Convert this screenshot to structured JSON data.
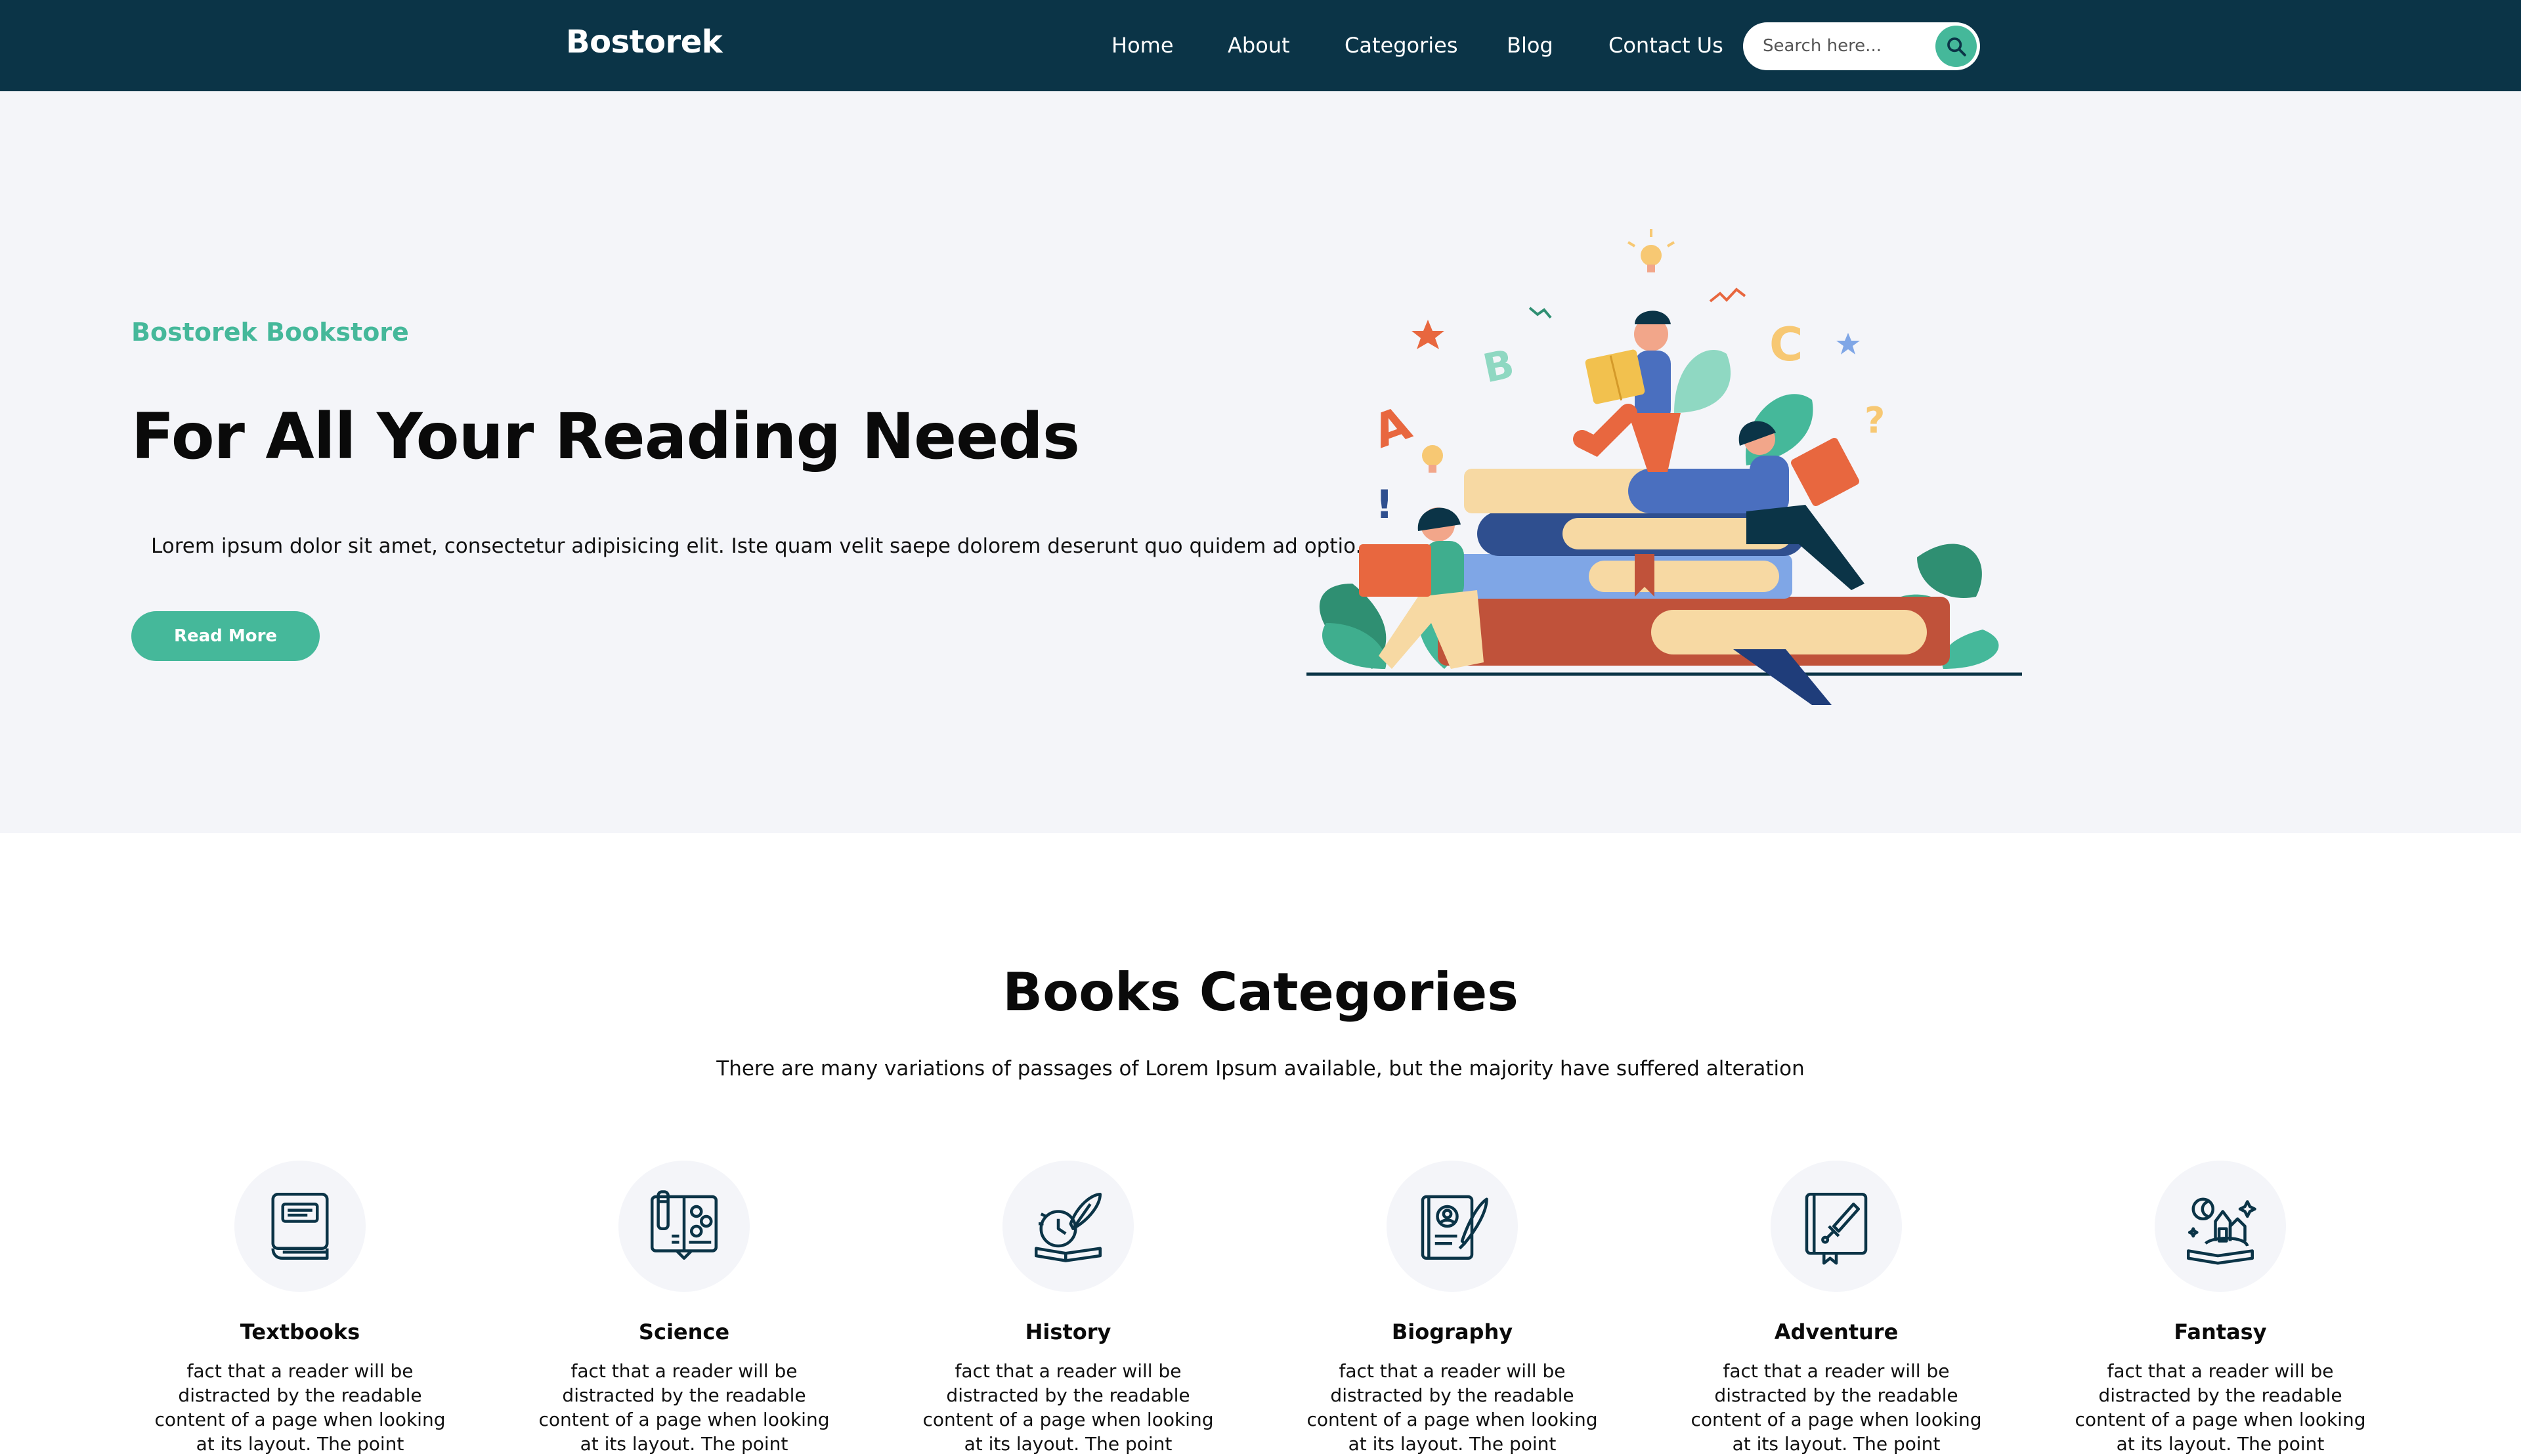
{
  "nav": {
    "brand": "Bostorek",
    "links": [
      "Home",
      "About",
      "Categories",
      "Blog",
      "Contact Us"
    ],
    "search_placeholder": "Search here..."
  },
  "hero": {
    "kicker": "Bostorek Bookstore",
    "title": "For All Your Reading Needs",
    "text": "Lorem ipsum dolor sit amet, consectetur adipisicing elit. Iste quam velit saepe dolorem deserunt quo quidem ad optio.",
    "button": "Read More"
  },
  "illustration_letters": [
    "A",
    "B",
    "C",
    "?",
    "!"
  ],
  "categories": {
    "title": "Books Categories",
    "subtitle": "There are many variations of passages of Lorem Ipsum available, but the majority have suffered alteration",
    "items": [
      {
        "name": "Textbooks",
        "icon": "textbook-icon",
        "desc": "fact that a reader will be distracted by the readable content of a page when looking at its layout. The point"
      },
      {
        "name": "Science",
        "icon": "science-icon",
        "desc": "fact that a reader will be distracted by the readable content of a page when looking at its layout. The point"
      },
      {
        "name": "History",
        "icon": "history-icon",
        "desc": "fact that a reader will be distracted by the readable content of a page when looking at its layout. The point"
      },
      {
        "name": "Biography",
        "icon": "biography-icon",
        "desc": "fact that a reader will be distracted by the readable content of a page when looking at its layout. The point"
      },
      {
        "name": "Adventure",
        "icon": "adventure-icon",
        "desc": "fact that a reader will be distracted by the readable content of a page when looking at its layout. The point"
      },
      {
        "name": "Fantasy",
        "icon": "fantasy-icon",
        "desc": "fact that a reader will be distracted by the readable content of a page when looking at its layout. The point"
      }
    ]
  },
  "colors": {
    "navbar": "#0b3447",
    "accent": "#45b89a",
    "hero_bg": "#f4f5f9",
    "icon_stroke": "#0b3447"
  }
}
